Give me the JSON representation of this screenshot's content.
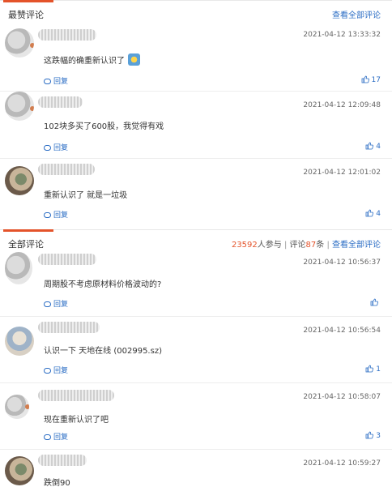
{
  "top": {
    "title": "最赞评论",
    "view_all": "查看全部评论",
    "comments": [
      {
        "time": "2021-04-12 13:33:32",
        "text": "这跌幅的确重新认识了",
        "reply": "回复",
        "likes": "17"
      },
      {
        "time": "2021-04-12 12:09:48",
        "text": "102块多买了600股，我觉得有戏",
        "reply": "回复",
        "likes": "4"
      },
      {
        "time": "2021-04-12 12:01:02",
        "text": "重新认识了 就是一垃圾",
        "reply": "回复",
        "likes": "4"
      }
    ]
  },
  "all": {
    "title": "全部评论",
    "participants": "23592",
    "participants_label": "人参与",
    "divider": "|",
    "comments_label_pre": "评论",
    "comments_count": "87",
    "comments_label_post": "条",
    "view_all": "查看全部评论",
    "comments": [
      {
        "time": "2021-04-12 10:56:37",
        "text": "周期股不考虑原材料价格波动的?",
        "reply": "回复",
        "likes": ""
      },
      {
        "time": "2021-04-12 10:56:54",
        "text": "认识一下 天地在线 (002995.sz)",
        "reply": "回复",
        "likes": "1"
      },
      {
        "time": "2021-04-12 10:58:07",
        "text": "现在重新认识了吧",
        "reply": "回复",
        "likes": "3"
      },
      {
        "time": "2021-04-12 10:59:27",
        "text": "跌倒90",
        "reply": "",
        "likes": ""
      }
    ]
  },
  "colors": {
    "accent": "#e4532a",
    "link": "#2a6cc4"
  },
  "icons": {
    "reply": "speech-bubble-icon",
    "like": "thumbs-up-icon"
  }
}
